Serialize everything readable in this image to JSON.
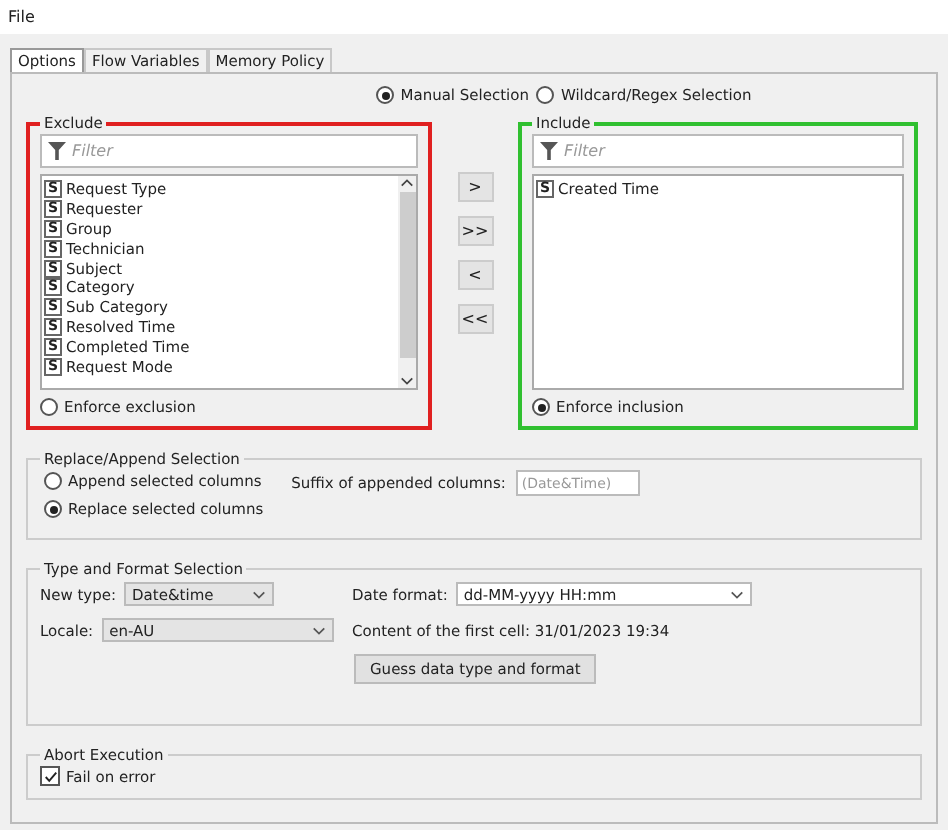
{
  "menu": [
    "File"
  ],
  "tabs": [
    {
      "label": "Options",
      "selected": true
    },
    {
      "label": "Flow Variables",
      "selected": false
    },
    {
      "label": "Memory Policy",
      "selected": false
    }
  ],
  "selection_mode": [
    {
      "label": "Manual Selection",
      "selected": true
    },
    {
      "label": "Wildcard/Regex Selection",
      "selected": false
    }
  ],
  "exclude": {
    "title": "Exclude",
    "filter_placeholder": "Filter",
    "items": [
      {
        "type": "S",
        "name": "Request Type"
      },
      {
        "type": "S",
        "name": "Requester"
      },
      {
        "type": "S",
        "name": "Group"
      },
      {
        "type": "S",
        "name": "Technician"
      },
      {
        "type": "S",
        "name": "Subject"
      },
      {
        "type": "S",
        "name": "Category"
      },
      {
        "type": "S",
        "name": "Sub Category"
      },
      {
        "type": "S",
        "name": "Resolved Time"
      },
      {
        "type": "S",
        "name": "Completed Time"
      },
      {
        "type": "S",
        "name": "Request Mode"
      }
    ],
    "enforce": {
      "label": "Enforce exclusion",
      "selected": false
    }
  },
  "move_buttons": [
    ">",
    ">>",
    "<",
    "<<"
  ],
  "include": {
    "title": "Include",
    "filter_placeholder": "Filter",
    "items": [
      {
        "type": "S",
        "name": "Created Time"
      }
    ],
    "enforce": {
      "label": "Enforce inclusion",
      "selected": true
    }
  },
  "replace_append": {
    "title": "Replace/Append Selection",
    "options": [
      {
        "label": "Append selected columns",
        "selected": false
      },
      {
        "label": "Replace selected columns",
        "selected": true
      }
    ],
    "suffix_label": "Suffix of appended columns:",
    "suffix_value": "(Date&Time)",
    "suffix_disabled": true
  },
  "type_format": {
    "title": "Type and Format Selection",
    "new_type_label": "New type:",
    "new_type": "Date&time",
    "date_format_label": "Date format:",
    "date_format": "dd-MM-yyyy HH:mm",
    "locale_label": "Locale:",
    "locale": "en-AU",
    "first_cell": "Content of the first cell: 31/01/2023 19:34",
    "guess_button": "Guess data type and format"
  },
  "abort": {
    "title": "Abort Execution",
    "fail_on_error": {
      "label": "Fail on error",
      "checked": true
    }
  }
}
